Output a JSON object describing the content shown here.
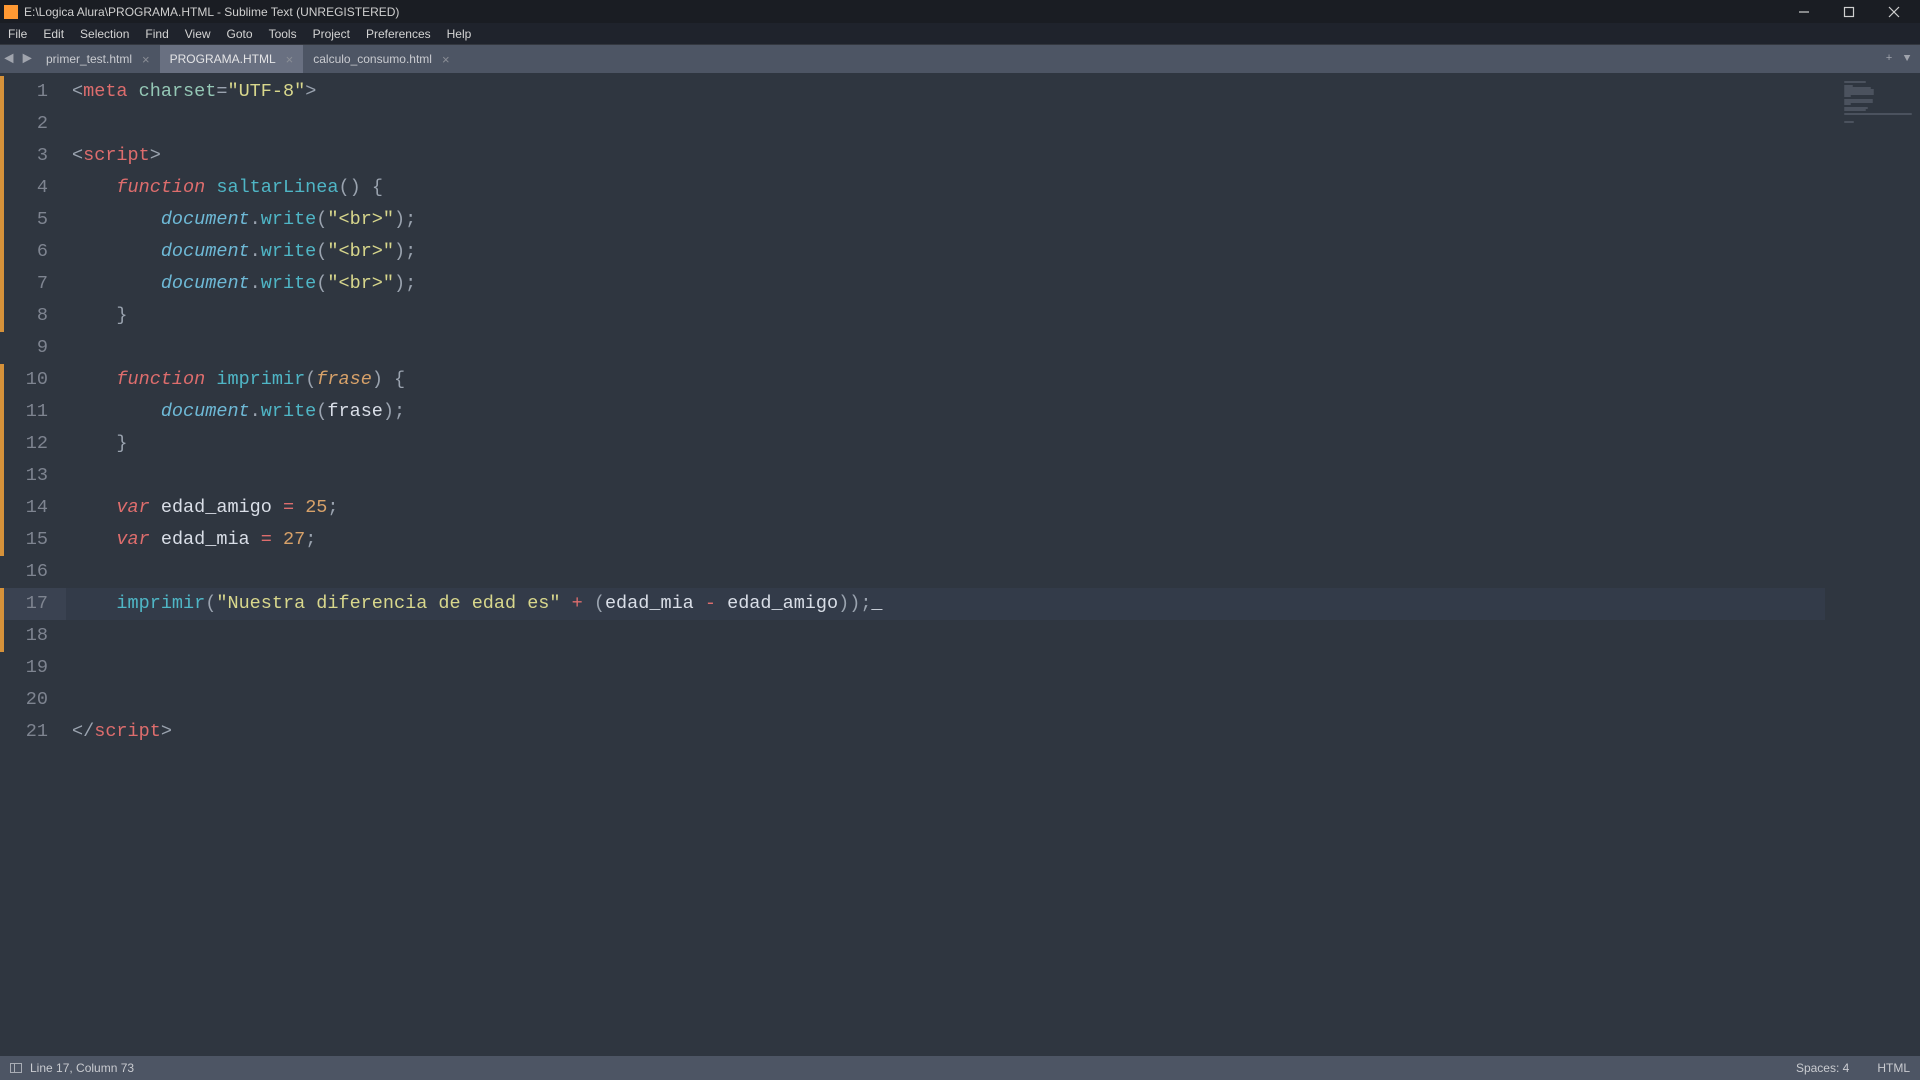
{
  "title_bar": {
    "text": "E:\\Logica Alura\\PROGRAMA.HTML - Sublime Text (UNREGISTERED)"
  },
  "menu": {
    "items": [
      "File",
      "Edit",
      "Selection",
      "Find",
      "View",
      "Goto",
      "Tools",
      "Project",
      "Preferences",
      "Help"
    ]
  },
  "tabs": [
    {
      "label": "primer_test.html",
      "active": false
    },
    {
      "label": "PROGRAMA.HTML",
      "active": true
    },
    {
      "label": "calculo_consumo.html",
      "active": false
    }
  ],
  "code_lines": [
    {
      "n": 1,
      "tokens": [
        [
          "tok-punc",
          "<"
        ],
        [
          "tok-tag",
          "meta"
        ],
        [
          "",
          " "
        ],
        [
          "tok-attr",
          "charset"
        ],
        [
          "tok-punc",
          "="
        ],
        [
          "tok-str",
          "\"UTF-8\""
        ],
        [
          "tok-punc",
          ">"
        ]
      ]
    },
    {
      "n": 2,
      "tokens": []
    },
    {
      "n": 3,
      "tokens": [
        [
          "tok-punc",
          "<"
        ],
        [
          "tok-tag",
          "script"
        ],
        [
          "tok-punc",
          ">"
        ]
      ]
    },
    {
      "n": 4,
      "tokens": [
        [
          "",
          "    "
        ],
        [
          "tok-kw",
          "function"
        ],
        [
          "",
          " "
        ],
        [
          "tok-func",
          "saltarLinea"
        ],
        [
          "tok-punc",
          "()"
        ],
        [
          "",
          " "
        ],
        [
          "tok-punc",
          "{"
        ]
      ]
    },
    {
      "n": 5,
      "tokens": [
        [
          "",
          "        "
        ],
        [
          "tok-obj",
          "document"
        ],
        [
          "tok-punc",
          "."
        ],
        [
          "tok-method",
          "write"
        ],
        [
          "tok-punc",
          "("
        ],
        [
          "tok-str",
          "\"<br>\""
        ],
        [
          "tok-punc",
          ");"
        ]
      ]
    },
    {
      "n": 6,
      "tokens": [
        [
          "",
          "        "
        ],
        [
          "tok-obj",
          "document"
        ],
        [
          "tok-punc",
          "."
        ],
        [
          "tok-method",
          "write"
        ],
        [
          "tok-punc",
          "("
        ],
        [
          "tok-str",
          "\"<br>\""
        ],
        [
          "tok-punc",
          ");"
        ]
      ]
    },
    {
      "n": 7,
      "tokens": [
        [
          "",
          "        "
        ],
        [
          "tok-obj",
          "document"
        ],
        [
          "tok-punc",
          "."
        ],
        [
          "tok-method",
          "write"
        ],
        [
          "tok-punc",
          "("
        ],
        [
          "tok-str",
          "\"<br>\""
        ],
        [
          "tok-punc",
          ");"
        ]
      ]
    },
    {
      "n": 8,
      "tokens": [
        [
          "",
          "    "
        ],
        [
          "tok-punc",
          "}"
        ]
      ]
    },
    {
      "n": 9,
      "tokens": []
    },
    {
      "n": 10,
      "tokens": [
        [
          "",
          "    "
        ],
        [
          "tok-kw",
          "function"
        ],
        [
          "",
          " "
        ],
        [
          "tok-func",
          "imprimir"
        ],
        [
          "tok-punc",
          "("
        ],
        [
          "tok-param",
          "frase"
        ],
        [
          "tok-punc",
          ")"
        ],
        [
          "",
          " "
        ],
        [
          "tok-punc",
          "{"
        ]
      ]
    },
    {
      "n": 11,
      "tokens": [
        [
          "",
          "        "
        ],
        [
          "tok-obj",
          "document"
        ],
        [
          "tok-punc",
          "."
        ],
        [
          "tok-method",
          "write"
        ],
        [
          "tok-punc",
          "("
        ],
        [
          "",
          "frase"
        ],
        [
          "tok-punc",
          ");"
        ]
      ]
    },
    {
      "n": 12,
      "tokens": [
        [
          "",
          "    "
        ],
        [
          "tok-punc",
          "}"
        ]
      ]
    },
    {
      "n": 13,
      "tokens": []
    },
    {
      "n": 14,
      "tokens": [
        [
          "",
          "    "
        ],
        [
          "tok-stor",
          "var"
        ],
        [
          "",
          " edad_amigo "
        ],
        [
          "tok-op",
          "="
        ],
        [
          "",
          " "
        ],
        [
          "tok-num",
          "25"
        ],
        [
          "tok-punc",
          ";"
        ]
      ]
    },
    {
      "n": 15,
      "tokens": [
        [
          "",
          "    "
        ],
        [
          "tok-stor",
          "var"
        ],
        [
          "",
          " edad_mia "
        ],
        [
          "tok-op",
          "="
        ],
        [
          "",
          " "
        ],
        [
          "tok-num",
          "27"
        ],
        [
          "tok-punc",
          ";"
        ]
      ]
    },
    {
      "n": 16,
      "tokens": []
    },
    {
      "n": 17,
      "active": true,
      "tokens": [
        [
          "",
          "    "
        ],
        [
          "tok-method",
          "imprimir"
        ],
        [
          "tok-punc",
          "("
        ],
        [
          "tok-str",
          "\"Nuestra diferencia de edad es\""
        ],
        [
          "",
          " "
        ],
        [
          "tok-op",
          "+"
        ],
        [
          "",
          " "
        ],
        [
          "tok-punc",
          "("
        ],
        [
          "",
          "edad_mia "
        ],
        [
          "tok-op",
          "-"
        ],
        [
          "",
          " edad_amigo"
        ],
        [
          "tok-punc",
          "));"
        ],
        [
          "cursor",
          "_"
        ]
      ]
    },
    {
      "n": 18,
      "tokens": []
    },
    {
      "n": 19,
      "tokens": []
    },
    {
      "n": 20,
      "tokens": []
    },
    {
      "n": 21,
      "tokens": [
        [
          "tok-punc",
          "</"
        ],
        [
          "tok-tag",
          "script"
        ],
        [
          "tok-punc",
          ">"
        ]
      ]
    }
  ],
  "gutter_marks": [
    {
      "from": 1,
      "to": 8
    },
    {
      "from": 10,
      "to": 15
    },
    {
      "from": 17,
      "to": 18
    }
  ],
  "status": {
    "position": "Line 17, Column 73",
    "spaces": "Spaces: 4",
    "syntax": "HTML"
  }
}
